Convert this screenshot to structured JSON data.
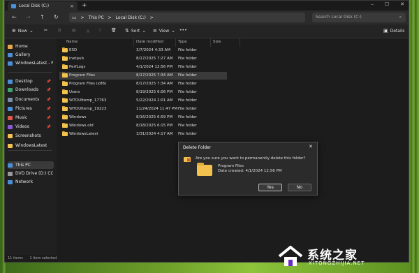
{
  "tab": {
    "title": "Local Disk (C:)",
    "close": "×",
    "new": "+"
  },
  "window_controls": {
    "minimize": "–",
    "maximize": "☐",
    "close": "✕"
  },
  "address": {
    "breadcrumb": [
      "This PC",
      "Local Disk (C:)"
    ],
    "separator": ">",
    "search_placeholder": "Search Local Disk (C:)"
  },
  "commands": {
    "new": "New",
    "sort": "Sort",
    "view": "View",
    "more": "•••",
    "details": "Details"
  },
  "sidebar": {
    "items": [
      {
        "label": "Home",
        "color": "#e8a84a"
      },
      {
        "label": "Gallery",
        "color": "#4a90d9"
      },
      {
        "label": "WindowsLatest - Pe",
        "color": "#4a90d9"
      },
      {
        "label": "Desktop",
        "color": "#4a90d9",
        "pinned": true
      },
      {
        "label": "Downloads",
        "color": "#3fa66a",
        "pinned": true
      },
      {
        "label": "Documents",
        "color": "#7a8fa6",
        "pinned": true
      },
      {
        "label": "Pictures",
        "color": "#4a90d9",
        "pinned": true
      },
      {
        "label": "Music",
        "color": "#e0584a",
        "pinned": true
      },
      {
        "label": "Videos",
        "color": "#8a5ad9",
        "pinned": true
      },
      {
        "label": "Screenshots",
        "color": "#f2c14e"
      },
      {
        "label": "WindowsLatest",
        "color": "#f2c14e"
      },
      {
        "label": "This PC",
        "color": "#4a90d9",
        "selected": true
      },
      {
        "label": "DVD Drive (D:) CCC",
        "color": "#999999"
      },
      {
        "label": "Network",
        "color": "#4a90d9"
      }
    ]
  },
  "columns": [
    "Name",
    "Date modified",
    "Type",
    "Size"
  ],
  "files": [
    {
      "name": "ESD",
      "date": "3/7/2024 4:33 AM",
      "type": "File folder"
    },
    {
      "name": "inetpub",
      "date": "8/17/2025 7:27 AM",
      "type": "File folder"
    },
    {
      "name": "PerfLogs",
      "date": "4/1/2024 12:56 PM",
      "type": "File folder"
    },
    {
      "name": "Program Files",
      "date": "8/17/2025 7:34 AM",
      "type": "File folder",
      "selected": true
    },
    {
      "name": "Program Files (x86)",
      "date": "8/17/2025 7:34 AM",
      "type": "File folder"
    },
    {
      "name": "Users",
      "date": "8/19/2025 6:06 PM",
      "type": "File folder"
    },
    {
      "name": "WTOUItemp_17763",
      "date": "5/22/2024 2:01 AM",
      "type": "File folder"
    },
    {
      "name": "WTOUItemp_19223",
      "date": "11/24/2024 11:47 PM",
      "type": "File folder"
    },
    {
      "name": "Windows",
      "date": "8/16/2025 6:59 PM",
      "type": "File folder"
    },
    {
      "name": "Windows.old",
      "date": "8/18/2025 6:15 PM",
      "type": "File folder"
    },
    {
      "name": "WindowsLatest",
      "date": "3/31/2024 4:17 AM",
      "type": "File folder"
    }
  ],
  "status": {
    "items": "11 items",
    "selected": "1 item selected"
  },
  "dialog": {
    "title": "Delete Folder",
    "question": "Are you sure you want to permanently delete this folder?",
    "folder_name": "Program Files",
    "date_created": "Date created: 4/1/2024 12:56 PM",
    "yes": "Yes",
    "no": "No"
  },
  "watermark": {
    "text": "系统之家",
    "sub": "XITONGZHIJIA.NET"
  }
}
